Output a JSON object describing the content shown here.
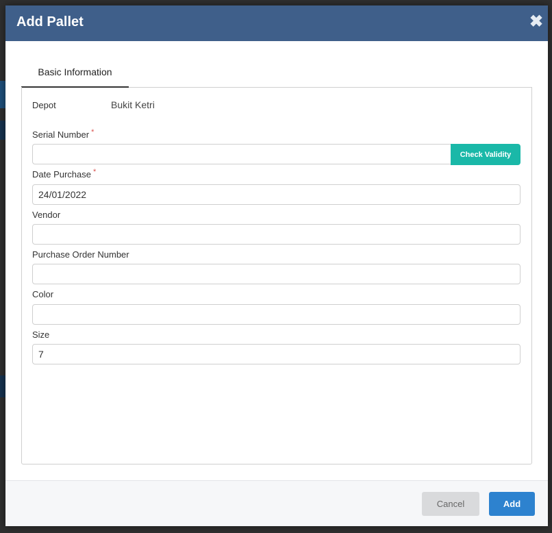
{
  "modal": {
    "title": "Add Pallet",
    "close_icon": "close-icon"
  },
  "tabs": [
    {
      "label": "Basic Information",
      "active": true
    }
  ],
  "form": {
    "depot": {
      "label": "Depot",
      "value": "Bukit Ketri"
    },
    "serial_number": {
      "label": "Serial Number",
      "required_mark": "*",
      "value": "",
      "check_label": "Check Validity"
    },
    "date_purchase": {
      "label": "Date Purchase",
      "required_mark": "*",
      "value": "24/01/2022"
    },
    "vendor": {
      "label": "Vendor",
      "value": ""
    },
    "purchase_order_number": {
      "label": "Purchase Order Number",
      "value": ""
    },
    "color": {
      "label": "Color",
      "value": ""
    },
    "size": {
      "label": "Size",
      "value": "7"
    }
  },
  "footer": {
    "cancel_label": "Cancel",
    "add_label": "Add"
  },
  "colors": {
    "header": "#3f5f8a",
    "check_button": "#1ab8a8",
    "add_button": "#2d82cf",
    "required": "#d9534f"
  }
}
